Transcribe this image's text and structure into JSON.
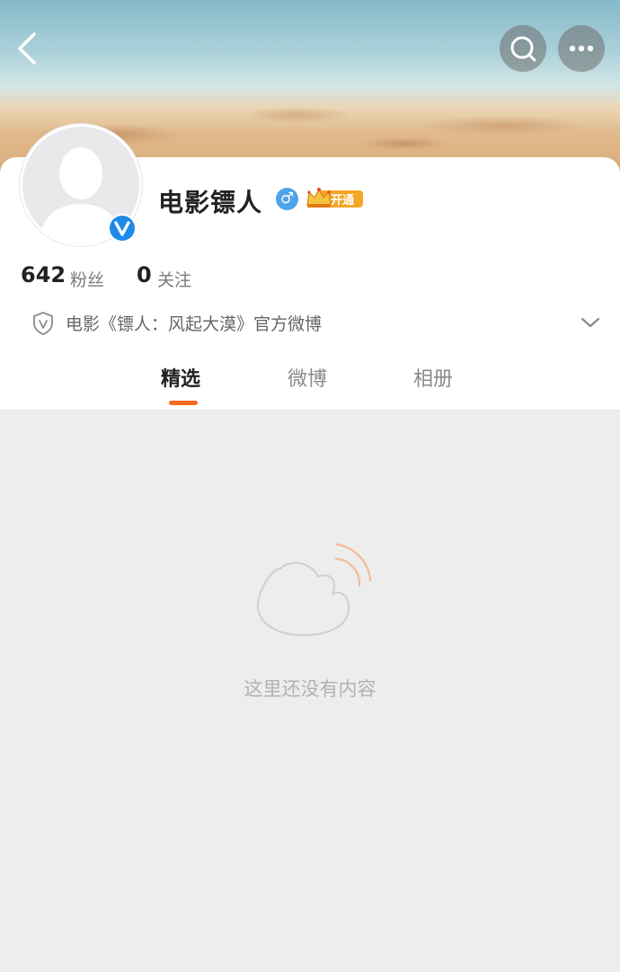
{
  "header": {
    "back_icon": "chevron-left-icon",
    "search_icon": "search-icon",
    "more_icon": "more-horizontal-icon"
  },
  "profile": {
    "name": "电影镖人",
    "gender_symbol": "♂",
    "vip_label": "开通",
    "verified_icon": "verified-v-icon",
    "followers_count": "642",
    "followers_label": "粉丝",
    "following_count": "0",
    "following_label": "关注",
    "description": "电影《镖人：风起大漠》官方微博"
  },
  "tabs": [
    {
      "label": "精选",
      "active": true
    },
    {
      "label": "微博",
      "active": false
    },
    {
      "label": "相册",
      "active": false
    }
  ],
  "empty_state": {
    "message": "这里还没有内容"
  },
  "colors": {
    "accent": "#f26b20",
    "verified_blue": "#1d8ae8",
    "gender_blue": "#4fa3e8",
    "vip_gold": "#f5a623",
    "background": "#ededed"
  }
}
